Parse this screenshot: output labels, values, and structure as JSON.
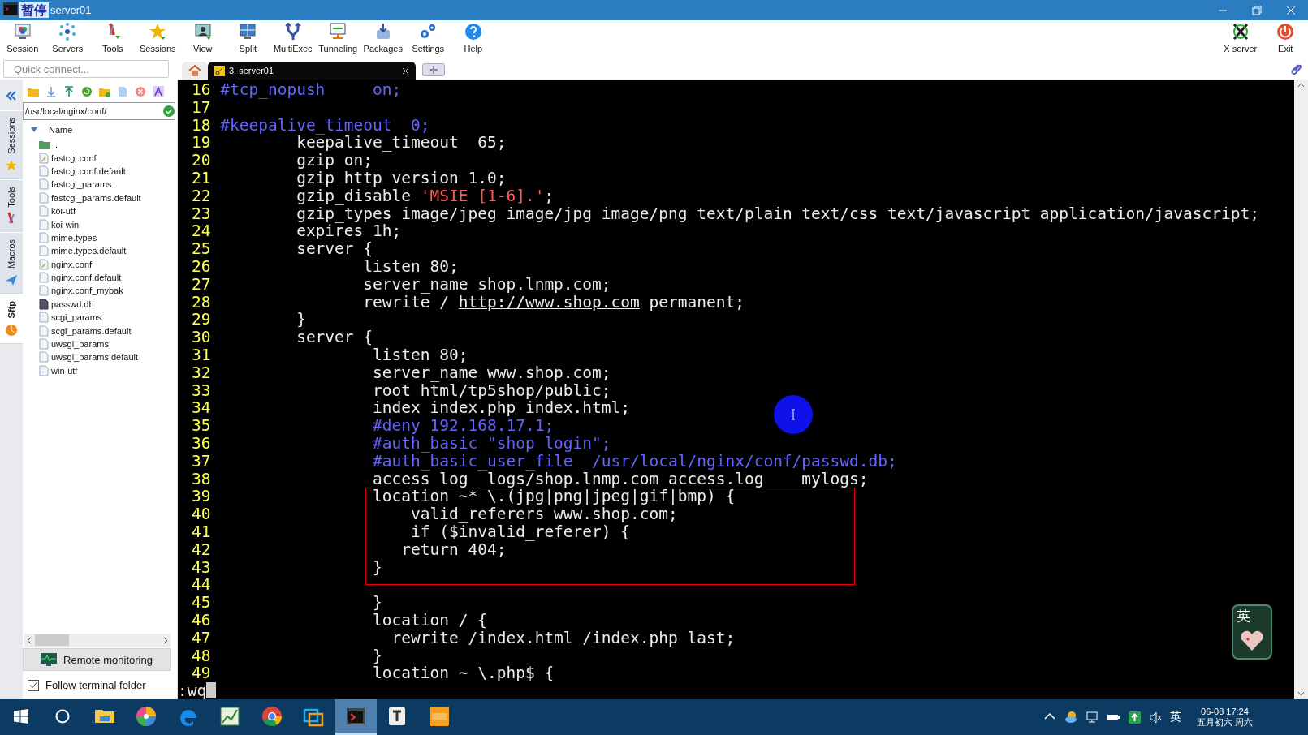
{
  "window": {
    "title": "server01",
    "overlay_badge": "暂停"
  },
  "toolbar": {
    "items": [
      {
        "label": "Session"
      },
      {
        "label": "Servers"
      },
      {
        "label": "Tools"
      },
      {
        "label": "Sessions"
      },
      {
        "label": "View"
      },
      {
        "label": "Split"
      },
      {
        "label": "MultiExec"
      },
      {
        "label": "Tunneling"
      },
      {
        "label": "Packages"
      },
      {
        "label": "Settings"
      },
      {
        "label": "Help"
      }
    ],
    "right_items": [
      {
        "label": "X server"
      },
      {
        "label": "Exit"
      }
    ]
  },
  "quick_connect": {
    "placeholder": "Quick connect..."
  },
  "tabs": [
    {
      "kind": "home",
      "selected": false
    },
    {
      "kind": "session",
      "label": "3. server01",
      "selected": true
    }
  ],
  "side_tabs": [
    {
      "label": "Sessions",
      "selected": false
    },
    {
      "label": "Tools",
      "selected": false
    },
    {
      "label": "Macros",
      "selected": false
    },
    {
      "label": "Sftp",
      "selected": true
    }
  ],
  "sftp": {
    "path": "/usr/local/nginx/conf/",
    "column": "Name",
    "files": [
      {
        "name": "..",
        "kind": "parent"
      },
      {
        "name": "fastcgi.conf",
        "kind": "edited"
      },
      {
        "name": "fastcgi.conf.default",
        "kind": "file"
      },
      {
        "name": "fastcgi_params",
        "kind": "file"
      },
      {
        "name": "fastcgi_params.default",
        "kind": "file"
      },
      {
        "name": "koi-utf",
        "kind": "file"
      },
      {
        "name": "koi-win",
        "kind": "file"
      },
      {
        "name": "mime.types",
        "kind": "file"
      },
      {
        "name": "mime.types.default",
        "kind": "file"
      },
      {
        "name": "nginx.conf",
        "kind": "edited"
      },
      {
        "name": "nginx.conf.default",
        "kind": "file"
      },
      {
        "name": "nginx.conf_mybak",
        "kind": "file"
      },
      {
        "name": "passwd.db",
        "kind": "db"
      },
      {
        "name": "scgi_params",
        "kind": "file"
      },
      {
        "name": "scgi_params.default",
        "kind": "file"
      },
      {
        "name": "uwsgi_params",
        "kind": "file"
      },
      {
        "name": "uwsgi_params.default",
        "kind": "file"
      },
      {
        "name": "win-utf",
        "kind": "file"
      }
    ],
    "monitor_button": "Remote monitoring",
    "follow": {
      "label": "Follow terminal folder",
      "checked": true
    }
  },
  "terminal": {
    "lines": [
      {
        "number": "16",
        "boxed": false,
        "segments": [
          {
            "kind": "comment",
            "text": "#tcp_nopush     on;"
          }
        ]
      },
      {
        "number": "17",
        "boxed": false
      },
      {
        "number": "18",
        "boxed": false,
        "segments": [
          {
            "kind": "comment",
            "text": "#keepalive_timeout  0;"
          }
        ]
      },
      {
        "number": "19",
        "boxed": false,
        "segments": [
          {
            "kind": "plain",
            "text": "        keepalive_timeout  65;"
          }
        ]
      },
      {
        "number": "20",
        "boxed": false,
        "segments": [
          {
            "kind": "plain",
            "text": "        gzip on;"
          }
        ]
      },
      {
        "number": "21",
        "boxed": false,
        "segments": [
          {
            "kind": "plain",
            "text": "        gzip_http_version 1.0;"
          }
        ]
      },
      {
        "number": "22",
        "boxed": false,
        "segments": [
          {
            "kind": "plain",
            "text": "        gzip_disable "
          },
          {
            "kind": "string",
            "text": "'MSIE [1-6].'"
          },
          {
            "kind": "plain",
            "text": ";"
          }
        ]
      },
      {
        "number": "23",
        "boxed": false,
        "segments": [
          {
            "kind": "plain",
            "text": "        gzip_types image/jpeg image/jpg image/png text/plain text/css text/javascript application/javascript;"
          }
        ]
      },
      {
        "number": "24",
        "boxed": false,
        "segments": [
          {
            "kind": "plain",
            "text": "        expires 1h;"
          }
        ]
      },
      {
        "number": "25",
        "boxed": false,
        "segments": [
          {
            "kind": "plain",
            "text": "        server {"
          }
        ]
      },
      {
        "number": "26",
        "boxed": false,
        "segments": [
          {
            "kind": "plain",
            "text": "               listen 80;"
          }
        ]
      },
      {
        "number": "27",
        "boxed": false,
        "segments": [
          {
            "kind": "plain",
            "text": "               server_name shop.lnmp.com;"
          }
        ]
      },
      {
        "number": "28",
        "boxed": false,
        "segments": [
          {
            "kind": "plain",
            "text": "               rewrite / "
          },
          {
            "kind": "link",
            "text": "http://www.shop.com"
          },
          {
            "kind": "plain",
            "text": " permanent;"
          }
        ]
      },
      {
        "number": "29",
        "boxed": false,
        "segments": [
          {
            "kind": "plain",
            "text": "        }"
          }
        ]
      },
      {
        "number": "30",
        "boxed": false,
        "segments": [
          {
            "kind": "plain",
            "text": "        server {"
          }
        ]
      },
      {
        "number": "31",
        "boxed": false,
        "segments": [
          {
            "kind": "plain",
            "text": "                listen 80;"
          }
        ]
      },
      {
        "number": "32",
        "boxed": false,
        "segments": [
          {
            "kind": "plain",
            "text": "                server_name www.shop.com;"
          }
        ]
      },
      {
        "number": "33",
        "boxed": false,
        "segments": [
          {
            "kind": "plain",
            "text": "                root html/tp5shop/public;"
          }
        ]
      },
      {
        "number": "34",
        "boxed": false,
        "segments": [
          {
            "kind": "plain",
            "text": "                index index.php index.html;"
          }
        ]
      },
      {
        "number": "35",
        "boxed": false,
        "segments": [
          {
            "kind": "comment",
            "text": "                #deny 192.168.17.1;"
          }
        ]
      },
      {
        "number": "36",
        "boxed": false,
        "segments": [
          {
            "kind": "comment",
            "text": "                #auth_basic \"shop login\";"
          }
        ]
      },
      {
        "number": "37",
        "boxed": false,
        "segments": [
          {
            "kind": "comment",
            "text": "                #auth_basic_user_file  /usr/local/nginx/conf/passwd.db;"
          }
        ]
      },
      {
        "number": "38",
        "boxed": false,
        "segments": [
          {
            "kind": "plain",
            "text": "                access_log  logs/shop.lnmp.com_access.log    mylogs;"
          }
        ]
      },
      {
        "number": "39",
        "boxed": true,
        "segments": [
          {
            "kind": "plain",
            "text": "                location ~* \\.(jpg|png|jpeg|gif|bmp) {"
          }
        ]
      },
      {
        "number": "40",
        "boxed": true,
        "segments": [
          {
            "kind": "plain",
            "text": "                    valid_referers www.shop.com;"
          }
        ]
      },
      {
        "number": "41",
        "boxed": true,
        "segments": [
          {
            "kind": "plain",
            "text": "                    if ($invalid_referer) {"
          }
        ]
      },
      {
        "number": "42",
        "boxed": true,
        "segments": [
          {
            "kind": "plain",
            "text": "                   return 404;"
          }
        ]
      },
      {
        "number": "43",
        "boxed": true,
        "segments": [
          {
            "kind": "plain",
            "text": "                }"
          }
        ]
      },
      {
        "number": "44",
        "boxed": false
      },
      {
        "number": "45",
        "boxed": false,
        "segments": [
          {
            "kind": "plain",
            "text": "                }"
          }
        ]
      },
      {
        "number": "46",
        "boxed": false,
        "segments": [
          {
            "kind": "plain",
            "text": "                location / {"
          }
        ]
      },
      {
        "number": "47",
        "boxed": false,
        "segments": [
          {
            "kind": "plain",
            "text": "                  rewrite /index.html /index.php last;"
          }
        ]
      },
      {
        "number": "48",
        "boxed": false,
        "segments": [
          {
            "kind": "plain",
            "text": "                }"
          }
        ]
      },
      {
        "number": "49",
        "boxed": false,
        "segments": [
          {
            "kind": "plain",
            "text": "                location ~ \\.php$ {"
          }
        ]
      }
    ],
    "command": ":wq"
  },
  "ime_widget": {
    "label": "英"
  },
  "taskbar": {
    "apps": [
      {
        "selected": false
      },
      {
        "selected": false
      },
      {
        "selected": false
      },
      {
        "selected": false
      },
      {
        "selected": false
      },
      {
        "selected": false
      },
      {
        "selected": true
      },
      {
        "selected": false
      },
      {
        "selected": false
      }
    ],
    "tray_ime": "英",
    "clock": "06-08 17:24",
    "date": "五月初六 周六"
  }
}
